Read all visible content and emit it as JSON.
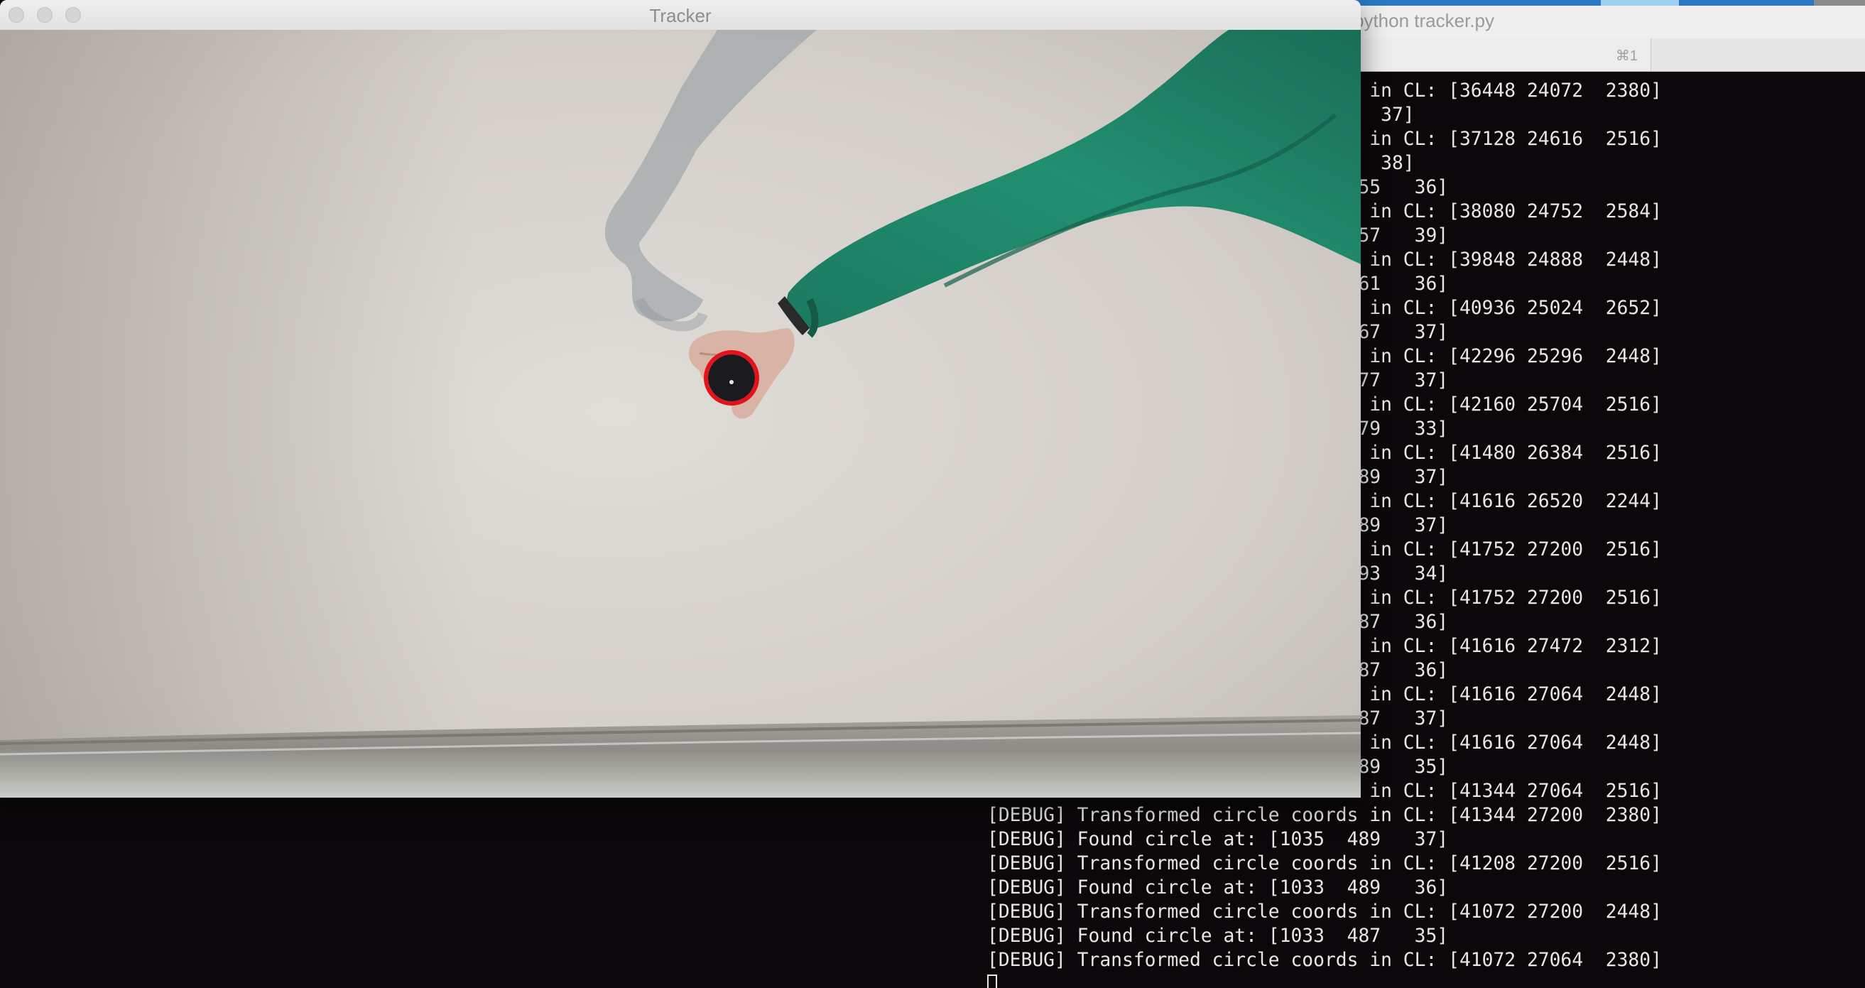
{
  "tracker": {
    "title": "Tracker"
  },
  "terminal": {
    "title": "python tracker.py",
    "tab_shortcut": "⌘1",
    "lines": [
      "                                  in CL: [36448 24072  2380]",
      "                                   37]",
      "                                  in CL: [37128 24616  2516]",
      "                                   38]",
      "                                 55   36]",
      "                                  in CL: [38080 24752  2584]",
      "                                 57   39]",
      "                                  in CL: [39848 24888  2448]",
      "                                 61   36]",
      "                                  in CL: [40936 25024  2652]",
      "                                 67   37]",
      "                                  in CL: [42296 25296  2448]",
      "                                 77   37]",
      "                                  in CL: [42160 25704  2516]",
      "                                 79   33]",
      "                                  in CL: [41480 26384  2516]",
      "                                 89   37]",
      "                                  in CL: [41616 26520  2244]",
      "                                 89   37]",
      "                                  in CL: [41752 27200  2516]",
      "                                 93   34]",
      "                                  in CL: [41752 27200  2516]",
      "                                 87   36]",
      "                                  in CL: [41616 27472  2312]",
      "                                 87   36]",
      "                                  in CL: [41616 27064  2448]",
      "                                 87   37]",
      "                                  in CL: [41616 27064  2448]",
      "                                 89   35]",
      "                                  in CL: [41344 27064  2516]",
      "[DEBUG] Transformed circle coords in CL: [41344 27200  2380]",
      "[DEBUG] Found circle at: [1035  489   37]",
      "[DEBUG] Transformed circle coords in CL: [41208 27200  2516]",
      "[DEBUG] Found circle at: [1033  489   36]",
      "[DEBUG] Transformed circle coords in CL: [41072 27200  2448]",
      "[DEBUG] Found circle at: [1033  487   35]",
      "[DEBUG] Transformed circle coords in CL: [41072 27064  2380]"
    ]
  },
  "colors": {
    "detection_ring": "#e3121b",
    "sweater": "#1f8a6c",
    "wall": "#d8d4cf"
  },
  "icons": {
    "close": "close-icon",
    "minimize": "minimize-icon",
    "maximize": "maximize-icon"
  }
}
